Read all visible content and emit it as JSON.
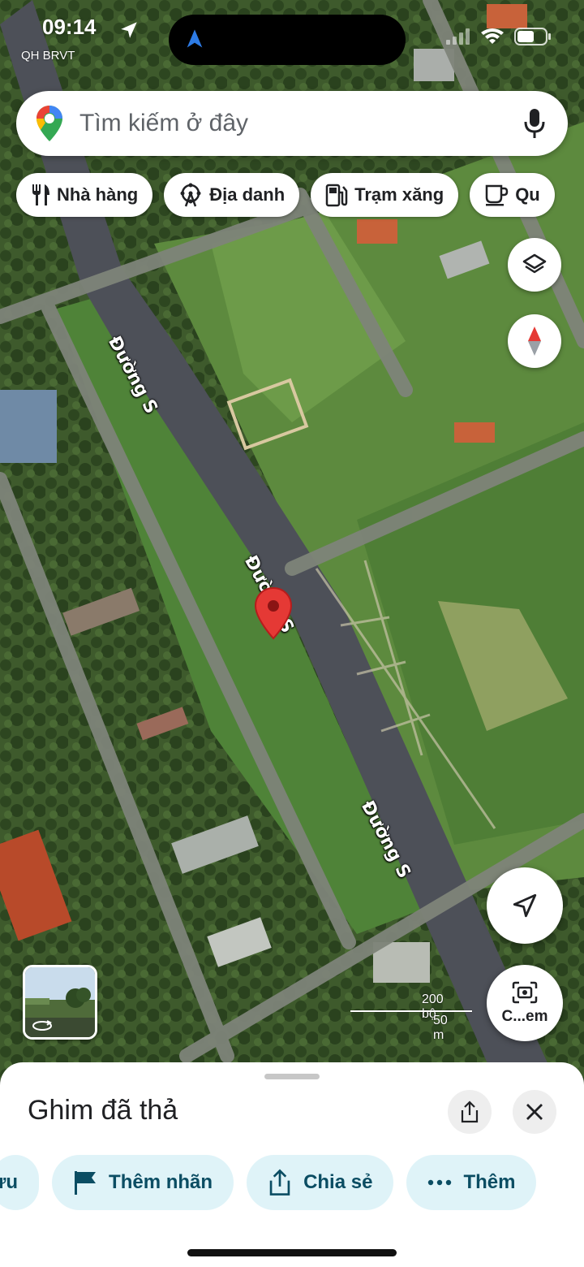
{
  "status": {
    "time": "09:14",
    "carrier": "QH BRVT"
  },
  "search": {
    "placeholder": "Tìm kiếm ở đây",
    "logo_icon": "google-maps-pin-icon",
    "mic_icon": "microphone-icon"
  },
  "chips": [
    {
      "label": "Nhà hàng",
      "icon": "fork-knife-icon"
    },
    {
      "label": "Địa danh",
      "icon": "ferris-wheel-icon"
    },
    {
      "label": "Trạm xăng",
      "icon": "gas-pump-icon"
    },
    {
      "label": "Qu",
      "icon": "coffee-cup-icon"
    }
  ],
  "map": {
    "road_labels": [
      "Đường S",
      "Đường S",
      "Đường S"
    ],
    "scale": {
      "feet": "200 bộ",
      "meters": "50 m"
    },
    "pin_color": "#e53935"
  },
  "fab": {
    "camera_label": "C...em"
  },
  "sheet": {
    "title": "Ghim đã thả",
    "actions": [
      {
        "label": "ưu",
        "icon": "bookmark-icon"
      },
      {
        "label": "Thêm nhãn",
        "icon": "flag-icon"
      },
      {
        "label": "Chia sẻ",
        "icon": "share-icon"
      },
      {
        "label": "Thêm",
        "icon": "more-dots-icon"
      }
    ]
  },
  "colors": {
    "accent": "#0b4d63",
    "chip_bg": "#dff3f8",
    "pin": "#e53935"
  }
}
